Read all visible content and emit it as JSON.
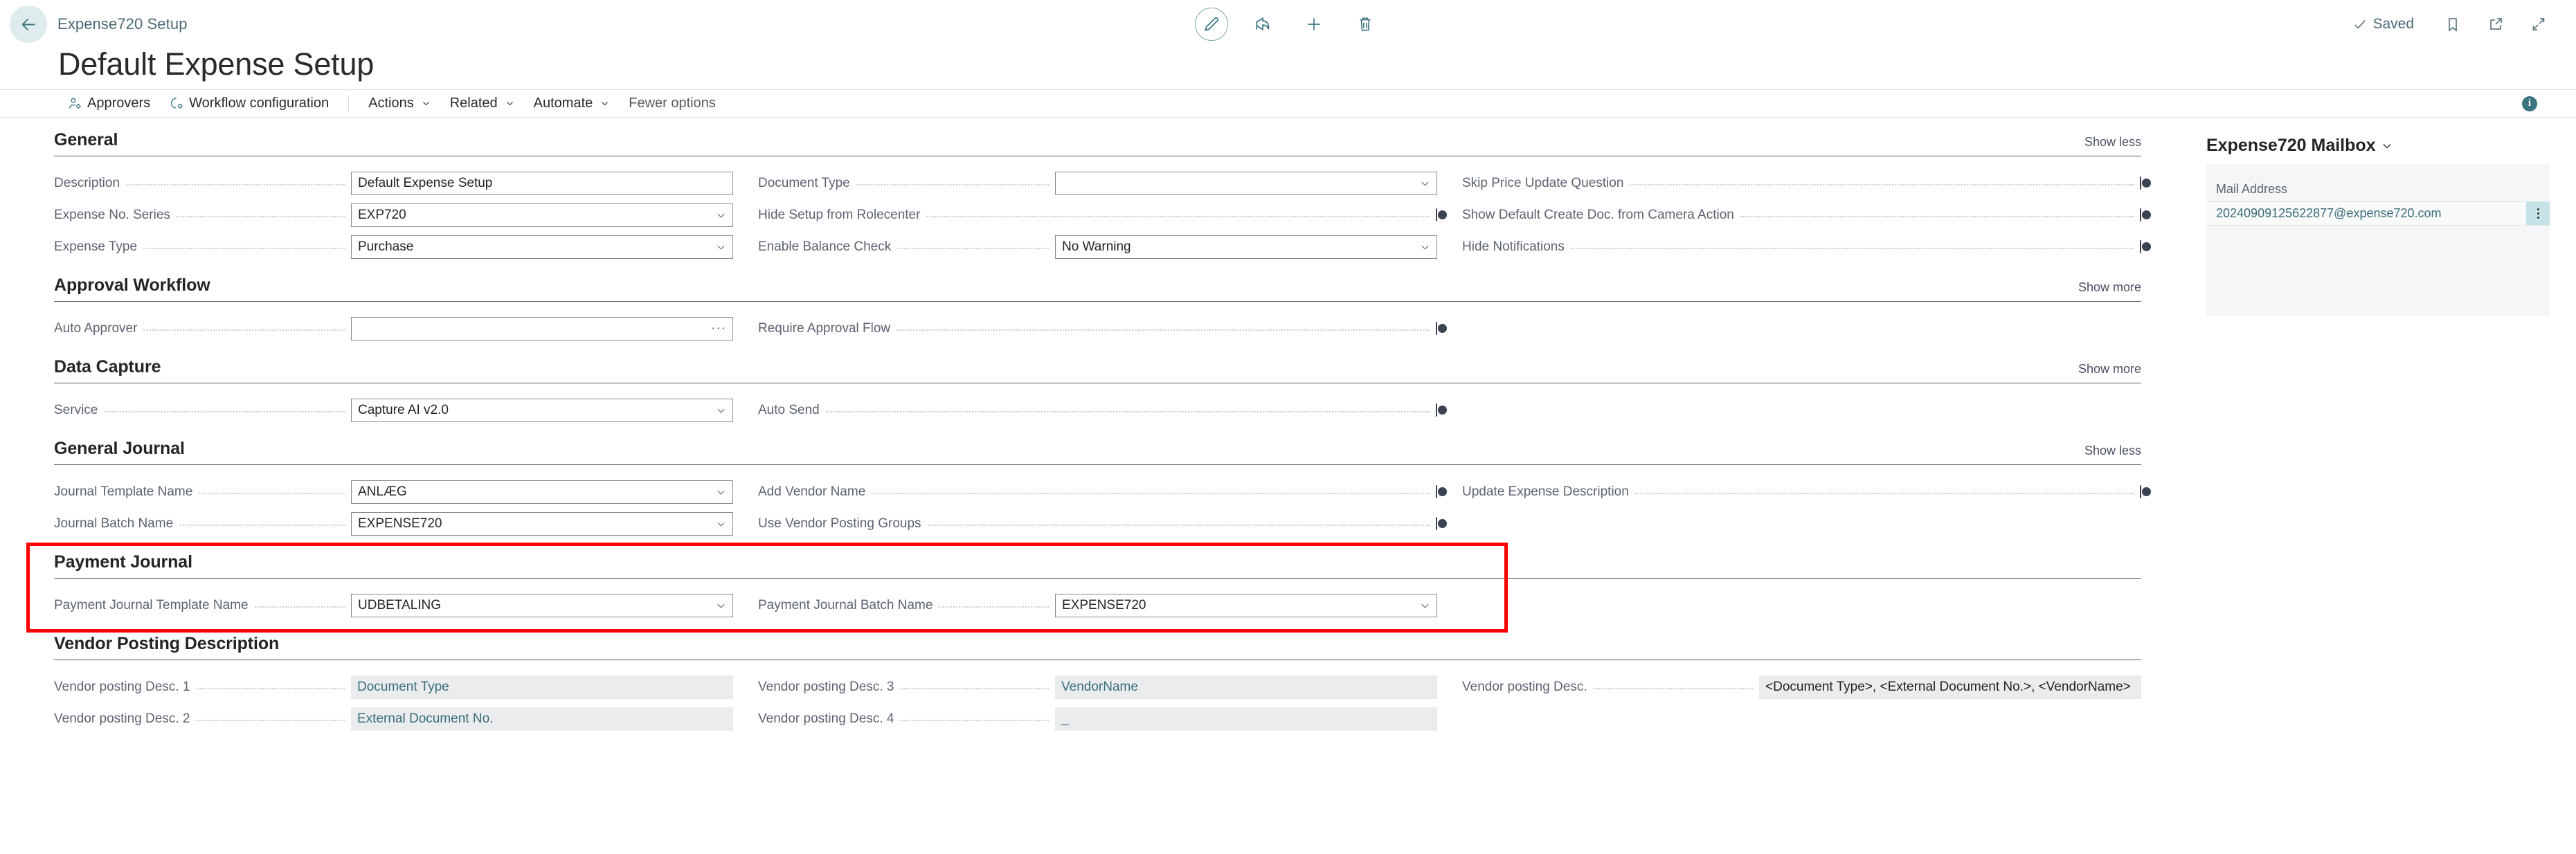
{
  "window": {
    "breadcrumb": "Expense720 Setup",
    "page_title": "Default Expense Setup",
    "back_icon": "back-arrow-icon",
    "saved_status": "Saved",
    "accent_color": "#3a7580",
    "highlight_color": "#ff0000"
  },
  "center_tools": [
    {
      "name": "edit-pencil-button",
      "icon": "pencil-icon"
    },
    {
      "name": "share-button",
      "icon": "share-icon"
    },
    {
      "name": "new-button",
      "icon": "plus-icon"
    },
    {
      "name": "delete-button",
      "icon": "trash-icon"
    }
  ],
  "right_tools": [
    {
      "name": "bookmark-button",
      "icon": "bookmark-icon"
    },
    {
      "name": "open-new-window-button",
      "icon": "open-in-new-window-icon"
    },
    {
      "name": "collapse-button",
      "icon": "collapse-arrows-icon"
    }
  ],
  "ribbon": {
    "approvers": "Approvers",
    "workflow_configuration": "Workflow configuration",
    "actions": "Actions",
    "related": "Related",
    "automate": "Automate",
    "fewer_options": "Fewer options",
    "info_badge": "i"
  },
  "sections": {
    "general": {
      "title": "General",
      "toggle": "Show less",
      "description_label": "Description",
      "description_value": "Default Expense Setup",
      "expense_no_series_label": "Expense No. Series",
      "expense_no_series_value": "EXP720",
      "expense_type_label": "Expense Type",
      "expense_type_value": "Purchase",
      "document_type_label": "Document Type",
      "document_type_value": "",
      "hide_setup_label": "Hide Setup from Rolecenter",
      "enable_balance_check_label": "Enable Balance Check",
      "enable_balance_check_value": "No Warning",
      "skip_price_label": "Skip Price Update Question",
      "show_default_create_label": "Show Default Create Doc. from Camera Action",
      "hide_notifications_label": "Hide Notifications"
    },
    "approval_workflow": {
      "title": "Approval Workflow",
      "toggle": "Show more",
      "auto_approver_label": "Auto Approver",
      "auto_approver_value": "",
      "auto_approver_assist": "···",
      "require_approval_flow_label": "Require Approval Flow"
    },
    "data_capture": {
      "title": "Data Capture",
      "toggle": "Show more",
      "service_label": "Service",
      "service_value": "Capture AI v2.0",
      "auto_send_label": "Auto Send"
    },
    "general_journal": {
      "title": "General Journal",
      "toggle": "Show less",
      "journal_template_label": "Journal Template Name",
      "journal_template_value": "ANLÆG",
      "journal_batch_label": "Journal Batch Name",
      "journal_batch_value": "EXPENSE720",
      "add_vendor_name_label": "Add Vendor Name",
      "use_vendor_posting_groups_label": "Use Vendor Posting Groups",
      "update_expense_description_label": "Update Expense Description"
    },
    "payment_journal": {
      "title": "Payment Journal",
      "template_label": "Payment Journal Template Name",
      "template_value": "UDBETALING",
      "batch_label": "Payment Journal Batch Name",
      "batch_value": "EXPENSE720"
    },
    "vendor_posting_description": {
      "title": "Vendor Posting Description",
      "desc1_label": "Vendor posting Desc. 1",
      "desc1_value": "Document Type",
      "desc2_label": "Vendor posting Desc. 2",
      "desc2_value": "External Document No.",
      "desc3_label": "Vendor posting Desc. 3",
      "desc3_value": "VendorName",
      "desc4_label": "Vendor posting Desc. 4",
      "desc4_value": "_",
      "preview_label": "Vendor posting Desc.",
      "preview_value": "<Document Type>, <External Document No.>, <VendorName>"
    }
  },
  "side_panel": {
    "title": "Expense720 Mailbox",
    "column_header": "Mail Address",
    "rows": [
      {
        "address": "20240909125622877@expense720.com"
      }
    ]
  }
}
